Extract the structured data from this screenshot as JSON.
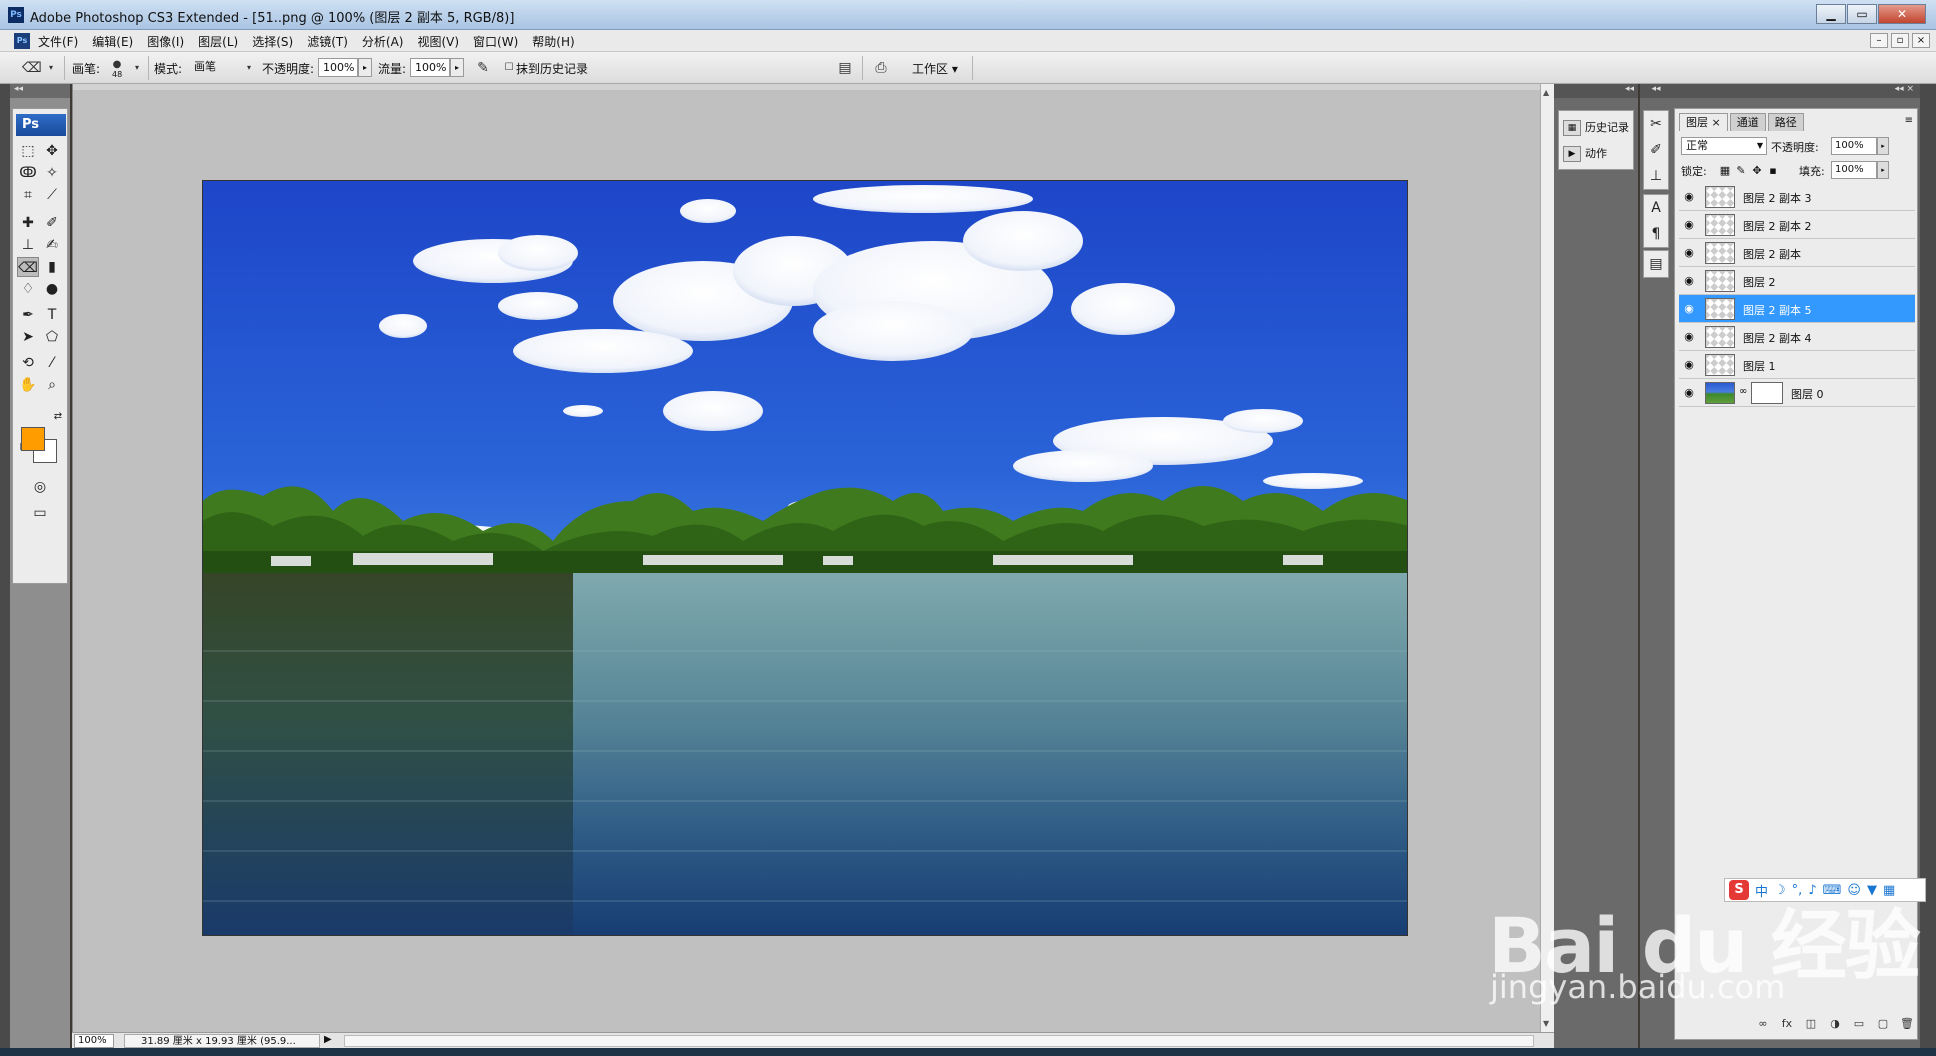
{
  "window": {
    "title": "Adobe Photoshop CS3 Extended - [51..png @ 100% (图层 2 副本 5, RGB/8)]",
    "app_icon": "Ps",
    "min_label": "▁",
    "max_label": "▭",
    "close_label": "✕"
  },
  "menu": {
    "items": [
      "文件(F)",
      "编辑(E)",
      "图像(I)",
      "图层(L)",
      "选择(S)",
      "滤镜(T)",
      "分析(A)",
      "视图(V)",
      "窗口(W)",
      "帮助(H)"
    ]
  },
  "options": {
    "brush_label": "画笔:",
    "brush_size": "48",
    "mode_label": "模式:",
    "mode_value": "画笔",
    "opacity_label": "不透明度:",
    "opacity_value": "100%",
    "flow_label": "流量:",
    "flow_value": "100%",
    "erase_history_label": "抹到历史记录",
    "workspace_label": "工作区 ▾"
  },
  "toolbox": {
    "logo": "Ps",
    "foreground_color": "#ff9c00",
    "background_color": "#ffffff"
  },
  "status": {
    "zoom": "100%",
    "doc_info": "31.89 厘米 x 19.93 厘米 (95.9...",
    "play": "▶"
  },
  "side_panels": {
    "history_label": "历史记录",
    "actions_label": "动作"
  },
  "layers_panel": {
    "tabs": [
      "图层 ×",
      "通道",
      "路径"
    ],
    "blend_mode": "正常",
    "opacity_label": "不透明度:",
    "opacity_value": "100%",
    "lock_label": "锁定:",
    "fill_label": "填充:",
    "fill_value": "100%",
    "layers": [
      {
        "name": "图层 2 副本 3",
        "selected": false
      },
      {
        "name": "图层 2 副本 2",
        "selected": false
      },
      {
        "name": "图层 2 副本",
        "selected": false
      },
      {
        "name": "图层 2",
        "selected": false
      },
      {
        "name": "图层 2 副本 5",
        "selected": true
      },
      {
        "name": "图层 2 副本 4",
        "selected": false
      },
      {
        "name": "图层 1",
        "selected": false
      },
      {
        "name": "图层 0",
        "selected": false,
        "has_mask": true
      }
    ],
    "footer_icons": [
      "link-icon",
      "fx-icon",
      "mask-icon",
      "adjustment-icon",
      "group-icon",
      "new-layer-icon",
      "trash-icon"
    ]
  },
  "ime_bar": {
    "logo": "S",
    "lang": "中"
  },
  "watermark": {
    "brand": "Bai du 经验",
    "url": "jingyan.baidu.com"
  }
}
